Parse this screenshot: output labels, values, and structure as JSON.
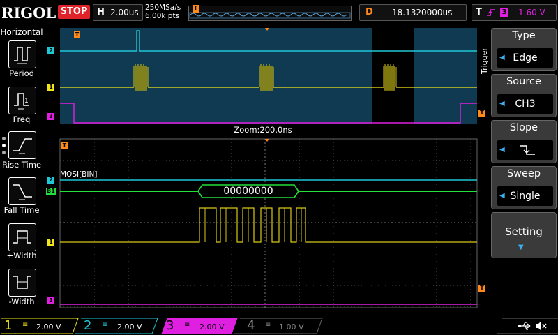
{
  "header": {
    "brand": "RIGOL",
    "run_state": "STOP",
    "timebase_label": "H",
    "timebase_value": "2.00us",
    "sample_rate": "250MSa/s",
    "memory_depth": "6.00k pts",
    "delay_label": "D",
    "delay_value": "18.1320000us",
    "trigger_label": "T",
    "trigger_channel": "3",
    "trigger_level": "1.60 V"
  },
  "left_menu": {
    "title": "Horizontal",
    "items": [
      {
        "label": "Period",
        "icon": "period-icon"
      },
      {
        "label": "Freq",
        "icon": "freq-icon"
      },
      {
        "label": "Rise Time",
        "icon": "rise-time-icon"
      },
      {
        "label": "Fall Time",
        "icon": "fall-time-icon"
      },
      {
        "label": "+Width",
        "icon": "pos-width-icon"
      },
      {
        "label": "-Width",
        "icon": "neg-width-icon"
      }
    ]
  },
  "screen": {
    "zoom_label": "Zoom:200.0ns",
    "decode_label": "MOSI[BIN]",
    "decode_value": "00000000",
    "markers": {
      "trigger": "T",
      "ch1": "1",
      "ch2": "2",
      "ch3": "3",
      "bus": "B1"
    }
  },
  "right_menu": {
    "side_label": "Trigger",
    "type_title": "Type",
    "type_value": "Edge",
    "source_title": "Source",
    "source_value": "CH3",
    "slope_title": "Slope",
    "sweep_title": "Sweep",
    "sweep_value": "Single",
    "setting_title": "Setting"
  },
  "channels": [
    {
      "num": "1",
      "scale": "2.00 V",
      "color": "#f2e61a"
    },
    {
      "num": "2",
      "scale": "2.00 V",
      "color": "#1fc8d6"
    },
    {
      "num": "3",
      "scale": "2.00 V",
      "color": "#e020e0"
    },
    {
      "num": "4",
      "scale": "1.00 V",
      "color": "#7a7aff"
    }
  ],
  "colors": {
    "ch1": "#f2e61a",
    "ch2": "#1fc8d6",
    "ch3": "#e020e0",
    "bus": "#22e03a",
    "trigger": "#ff8a1a",
    "stop": "#e0232a"
  }
}
